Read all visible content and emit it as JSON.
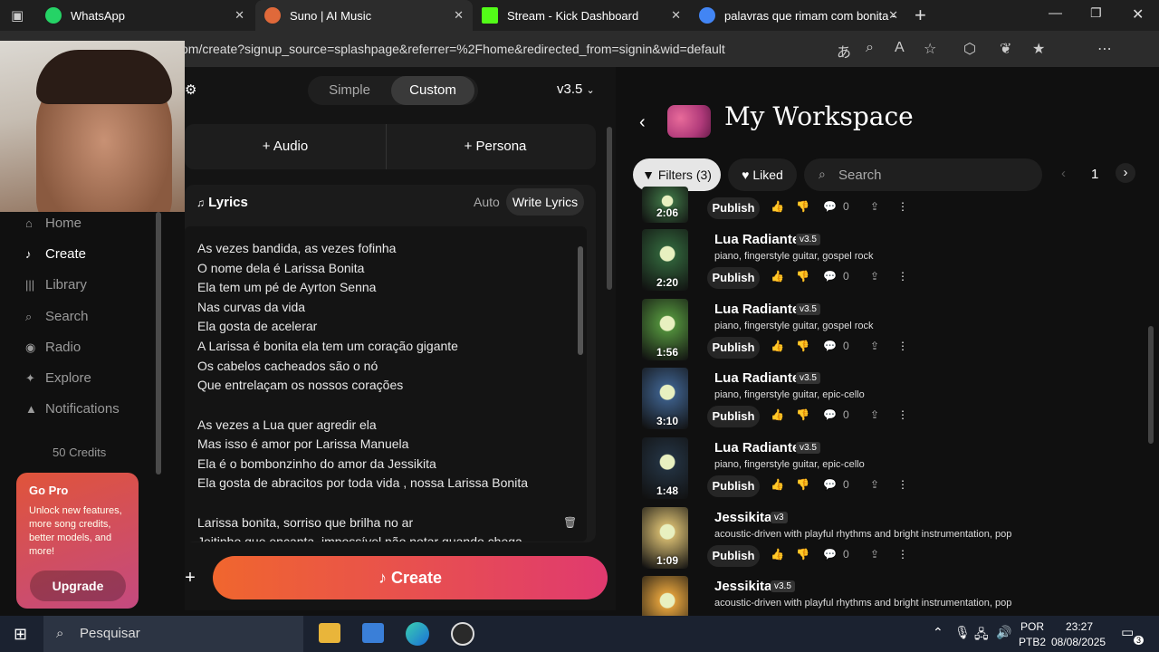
{
  "browser": {
    "tabs": [
      {
        "label": "WhatsApp",
        "color": "#25d366"
      },
      {
        "label": "Suno | AI Music",
        "color": "#e0693a"
      },
      {
        "label": "Stream - Kick Dashboard",
        "color": "#53fc18"
      },
      {
        "label": "palavras que rimam com bonita -",
        "color": "#4285f4"
      }
    ],
    "url": "om/create?signup_source=splashpage&referrer=%2Fhome&redirected_from=signin&wid=default"
  },
  "sidebar": {
    "items": [
      {
        "label": "Home",
        "icon": "home-icon"
      },
      {
        "label": "Create",
        "icon": "create-icon"
      },
      {
        "label": "Library",
        "icon": "library-icon"
      },
      {
        "label": "Search",
        "icon": "search-icon"
      },
      {
        "label": "Radio",
        "icon": "radio-icon"
      },
      {
        "label": "Explore",
        "icon": "explore-icon"
      },
      {
        "label": "Notifications",
        "icon": "bell-icon"
      }
    ],
    "credits": "50 Credits",
    "gopro": {
      "title": "Go Pro",
      "text": "Unlock new features, more song credits, better models, and more!",
      "button": "Upgrade"
    }
  },
  "create": {
    "mode_simple": "Simple",
    "mode_custom": "Custom",
    "version": "v3.5",
    "audio": "Audio",
    "persona": "Persona",
    "lyrics_title": "Lyrics",
    "auto": "Auto",
    "write_lyrics": "Write Lyrics",
    "lyrics": [
      "As vezes bandida, as vezes fofinha",
      "O nome dela é Larissa Bonita",
      "Ela tem um pé de Ayrton Senna",
      "Nas curvas da vida",
      "Ela gosta de acelerar",
      "A Larissa é bonita ela tem um coração gigante",
      "Os cabelos cacheados são o nó",
      "Que entrelaçam os nossos corações",
      "",
      "As vezes a Lua quer agredir ela",
      "Mas isso é amor por Larissa Manuela",
      "Ela é o bombonzinho do amor da Jessikita",
      "Ela gosta de abracitos por toda vida , nossa Larissa Bonita",
      "",
      "Larissa bonita, sorriso que brilha no ar",
      "Jeitinho que encanta, impossível não notar quando chega"
    ],
    "create_button": "Create"
  },
  "workspace": {
    "title": "My Workspace",
    "filters": "Filters (3)",
    "liked": "Liked",
    "search_placeholder": "Search",
    "page": "1",
    "songs": [
      {
        "title": "",
        "version": "",
        "tags": "",
        "duration": "2:06",
        "publish": "Publish",
        "comments": "0",
        "thumb": "#3a6a40"
      },
      {
        "title": "Lua Radiante",
        "version": "v3.5",
        "tags": "piano, fingerstyle guitar, gospel rock",
        "duration": "2:20",
        "publish": "Publish",
        "comments": "0",
        "thumb": "#2f5e38"
      },
      {
        "title": "Lua Radiante",
        "version": "v3.5",
        "tags": "piano, fingerstyle guitar, gospel rock",
        "duration": "1:56",
        "publish": "Publish",
        "comments": "0",
        "thumb": "#4f8a3a"
      },
      {
        "title": "Lua Radiante",
        "version": "v3.5",
        "tags": "piano, fingerstyle guitar, epic-cello",
        "duration": "3:10",
        "publish": "Publish",
        "comments": "0",
        "thumb": "#3a5a82"
      },
      {
        "title": "Lua Radiante",
        "version": "v3.5",
        "tags": "piano, fingerstyle guitar, epic-cello",
        "duration": "1:48",
        "publish": "Publish",
        "comments": "0",
        "thumb": "#22303e"
      },
      {
        "title": "Jessikita",
        "version": "v3",
        "tags": "acoustic-driven with playful rhythms and bright instrumentation, pop",
        "duration": "1:09",
        "publish": "Publish",
        "comments": "0",
        "thumb": "#c9b06a"
      },
      {
        "title": "Jessikita",
        "version": "v3.5",
        "tags": "acoustic-driven with playful rhythms and bright instrumentation, pop",
        "duration": "",
        "publish": "",
        "comments": "",
        "thumb": "#d89a3a"
      }
    ]
  },
  "taskbar": {
    "search": "Pesquisar",
    "lang": "POR",
    "layout": "PTB2",
    "time": "23:27",
    "date": "08/08/2025",
    "notif": "3"
  }
}
